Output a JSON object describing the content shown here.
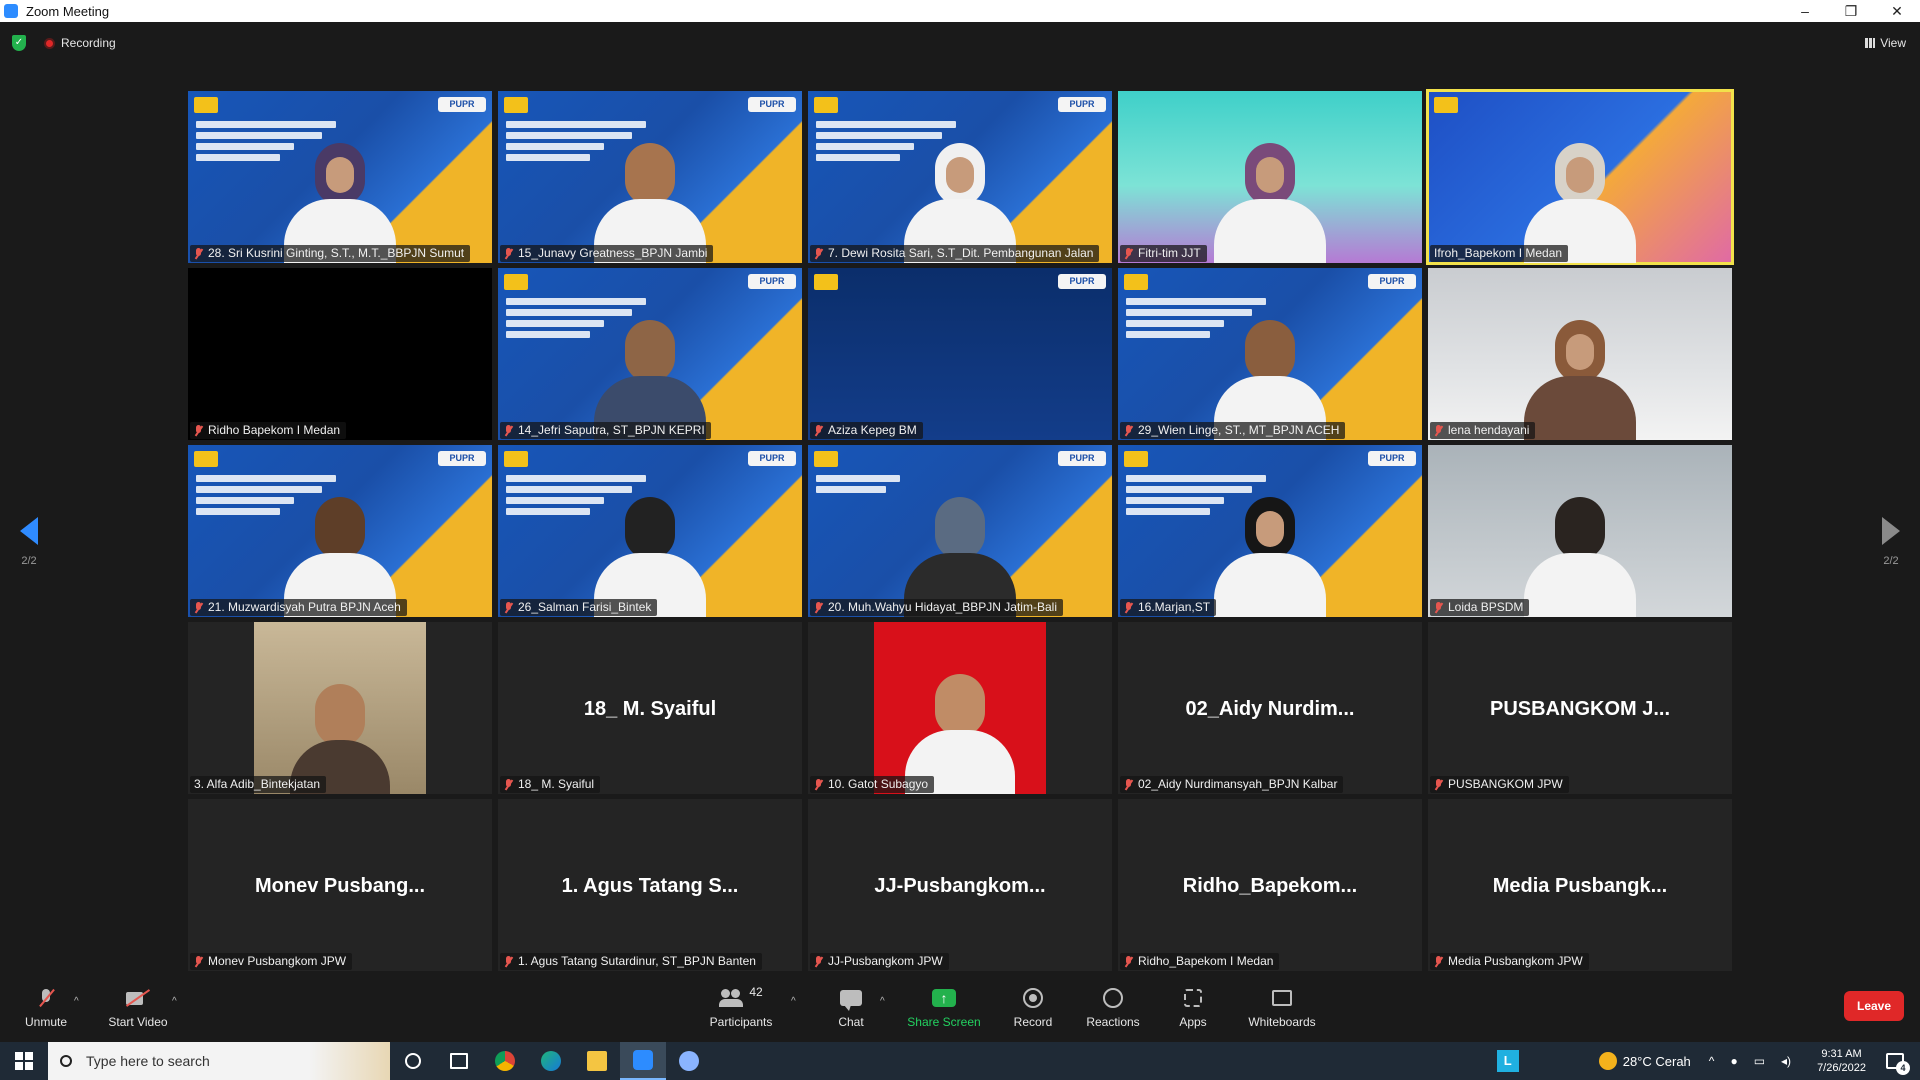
{
  "window": {
    "title": "Zoom Meeting",
    "controls": [
      "–",
      "❐",
      "✕"
    ]
  },
  "meeting": {
    "recording_label": "Recording",
    "view_label": "View"
  },
  "pager": {
    "page": "2/2"
  },
  "tiles": [
    {
      "name": "28. Sri Kusrini Ginting, S.T., M.T._BBPJN Sumut"
    },
    {
      "name": "15_Junavy Greatness_BPJN Jambi"
    },
    {
      "name": "7. Dewi Rosita Sari, S.T_Dit. Pembangunan Jalan"
    },
    {
      "name": "Fitri-tim JJT"
    },
    {
      "name": "Ifroh_Bapekom I Medan"
    },
    {
      "name": "Ridho Bapekom I Medan"
    },
    {
      "name": "14_Jefri Saputra, ST_BPJN KEPRI"
    },
    {
      "name": "Aziza Kepeg BM"
    },
    {
      "name": "29_Wien Linge, ST., MT_BPJN ACEH"
    },
    {
      "name": "lena hendayani"
    },
    {
      "name": "21. Muzwardisyah Putra BPJN Aceh"
    },
    {
      "name": "26_Salman Farisi_Bintek"
    },
    {
      "name": "20. Muh.Wahyu Hidayat_BBPJN Jatim-Bali"
    },
    {
      "name": "16.Marjan,ST"
    },
    {
      "name": "Loida BPSDM"
    },
    {
      "name": "3. Alfa Adib_Bintekjatan"
    },
    {
      "name": "18_ M. Syaiful",
      "display": "18_ M. Syaiful"
    },
    {
      "name": "10. Gatot Subagyo"
    },
    {
      "name": "02_Aidy Nurdimansyah_BPJN Kalbar",
      "display": "02_Aidy Nurdim..."
    },
    {
      "name": "PUSBANGKOM JPW",
      "display": "PUSBANGKOM J..."
    },
    {
      "name": "Monev Pusbangkom JPW",
      "display": "Monev Pusbang..."
    },
    {
      "name": "1. Agus Tatang Sutardinur, ST_BPJN Banten",
      "display": "1. Agus Tatang S..."
    },
    {
      "name": "JJ-Pusbangkom JPW",
      "display": "JJ-Pusbangkom..."
    },
    {
      "name": "Ridho_Bapekom I Medan",
      "display": "Ridho_Bapekom..."
    },
    {
      "name": "Media Pusbangkom JPW",
      "display": "Media Pusbangk..."
    }
  ],
  "toolbar": {
    "unmute": "Unmute",
    "start_video": "Start Video",
    "participants": "Participants",
    "participants_count": "42",
    "chat": "Chat",
    "share_screen": "Share Screen",
    "record": "Record",
    "reactions": "Reactions",
    "apps": "Apps",
    "whiteboards": "Whiteboards",
    "leave": "Leave"
  },
  "taskbar": {
    "search_placeholder": "Type here to search",
    "weather": "28°C  Cerah",
    "time": "9:31 AM",
    "date": "7/26/2022",
    "notifications": "4",
    "tray_app": "L"
  },
  "colors": {
    "accent": "#2d8cff",
    "share_green": "#23b14d",
    "leave_red": "#e02828",
    "active_speaker": "#f2e14b"
  }
}
